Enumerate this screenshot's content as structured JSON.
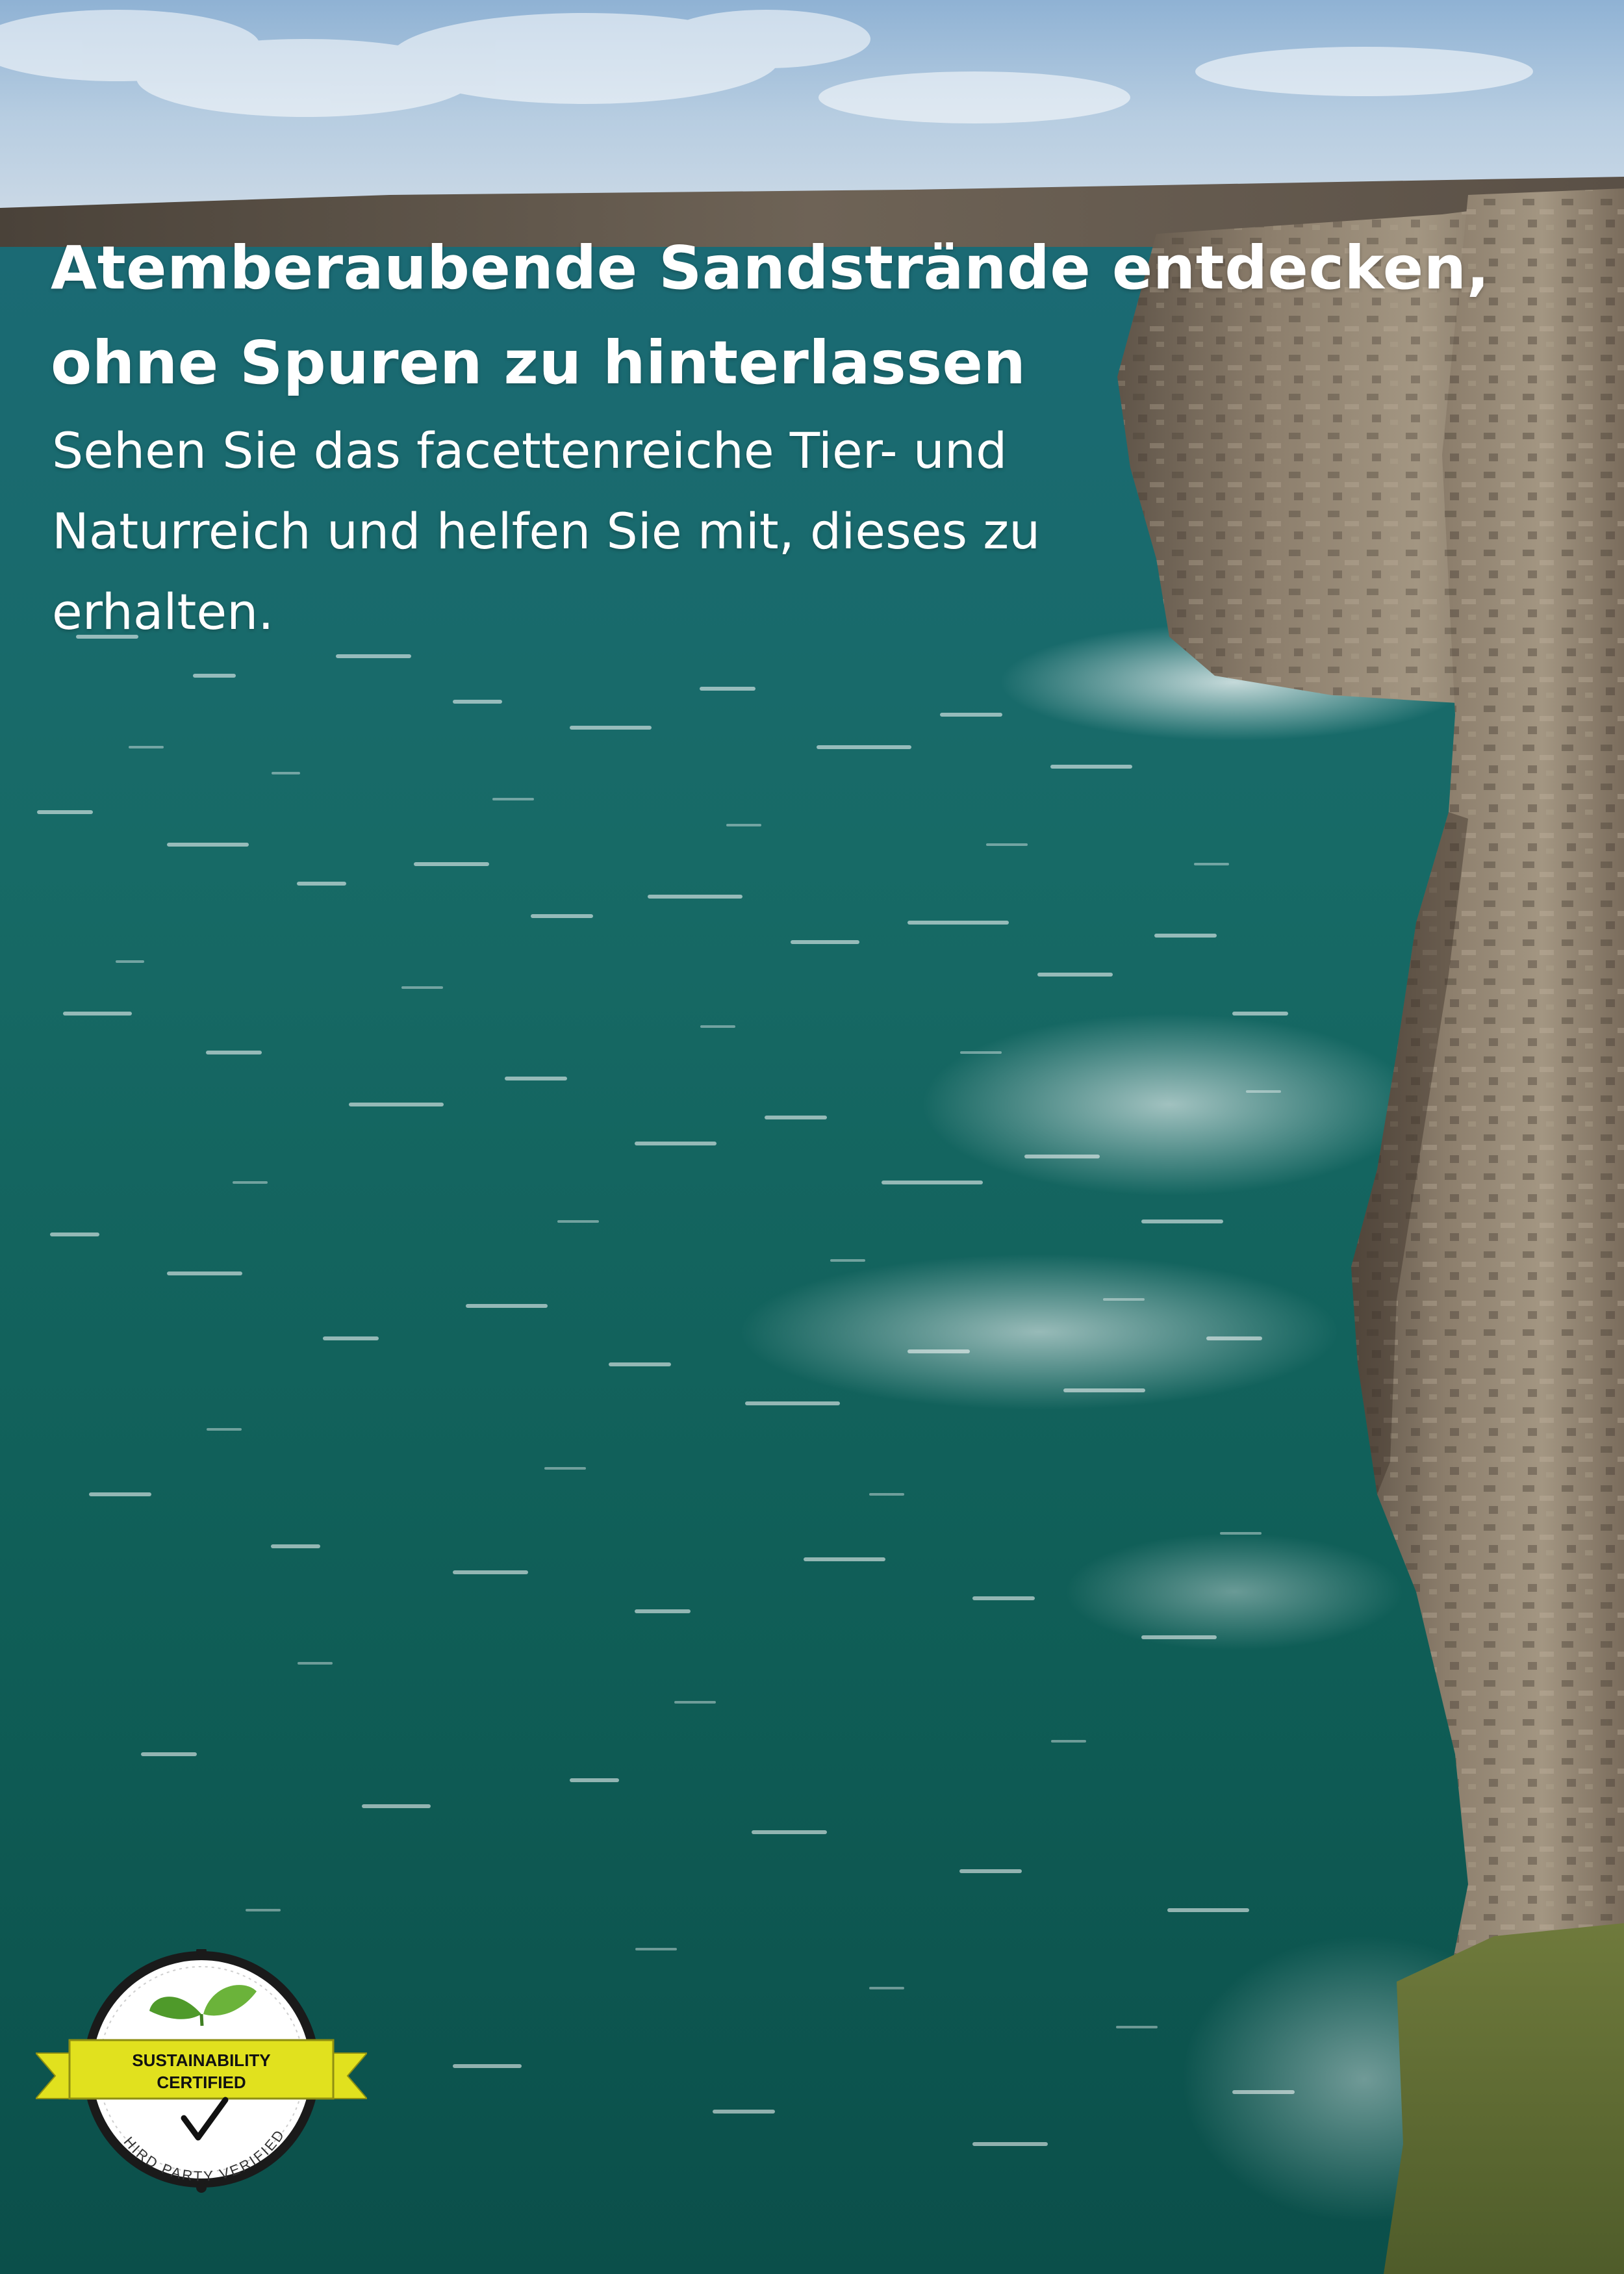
{
  "headline": "Atemberaubende Sandstrände entdecken, ohne Spuren zu hinterlassen",
  "subline": "Sehen Sie das facettenreiche Tier- und Naturreich und helfen Sie mit, dieses zu erhalten.",
  "seal": {
    "ribbon_line1": "SUSTAINABILITY",
    "ribbon_line2": "CERTIFIED",
    "arc_text": "THIRD PARTY VERIFIED",
    "icons": [
      "leaf-icon",
      "checkmark-icon"
    ]
  },
  "colors": {
    "sea": "#0d5a55",
    "sky": "#a9c4dc",
    "cliff": "#8a7b6a",
    "ribbon": "#e1e11e",
    "leaf": "#4f9a2a"
  }
}
